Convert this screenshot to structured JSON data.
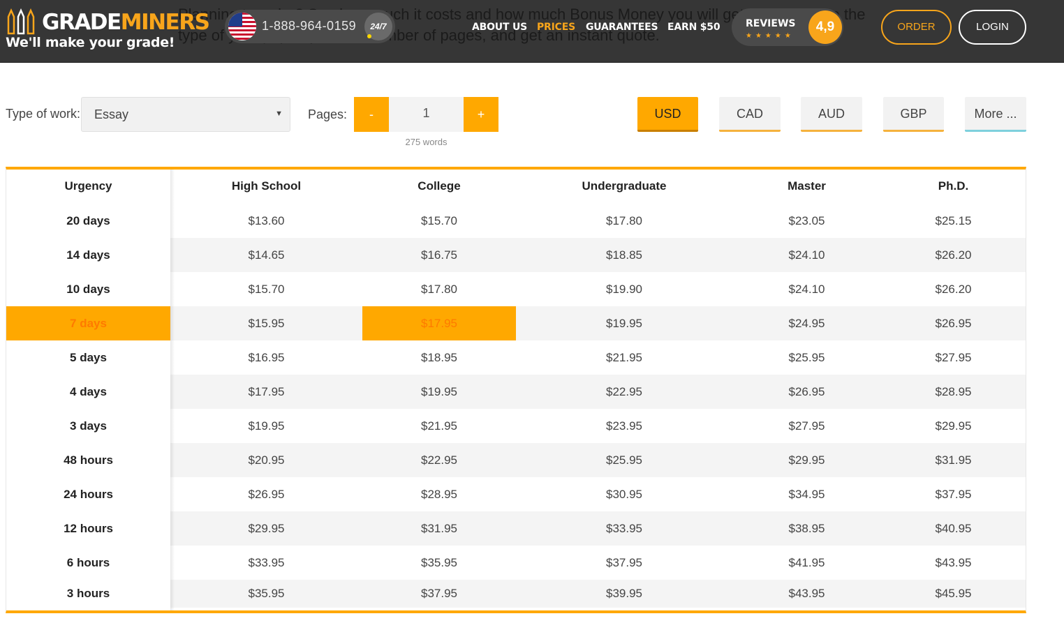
{
  "header": {
    "background_text": "Planning to order? See how much it costs and how much Bonus Money you will get for it. Choose the type of your paper, pick the number of pages, and get an instant quote.",
    "logo_text_1": "GRADE",
    "logo_text_2": "MINERS",
    "tagline": "We'll make your grade!",
    "phone": "1-888-964-0159",
    "support_badge": "24/7",
    "nav": [
      {
        "label": "ABOUT US",
        "active": false
      },
      {
        "label": "PRICES",
        "active": true
      },
      {
        "label": "GUARANTEES",
        "active": false
      },
      {
        "label": "EARN $50",
        "active": false
      }
    ],
    "reviews_label": "REVIEWS",
    "stars": "★★★★★",
    "rating": "4,9",
    "order_label": "ORDER",
    "login_label": "LOGIN"
  },
  "controls": {
    "type_label": "Type of work:",
    "type_value": "Essay",
    "pages_label": "Pages:",
    "minus": "-",
    "plus": "+",
    "pages_value": "1",
    "words": "275 words",
    "currencies": [
      {
        "label": "USD",
        "active": true
      },
      {
        "label": "CAD",
        "active": false
      },
      {
        "label": "AUD",
        "active": false
      },
      {
        "label": "GBP",
        "active": false
      },
      {
        "label": "More ...",
        "active": false
      }
    ]
  },
  "table": {
    "headers": [
      "Urgency",
      "High School",
      "College",
      "Undergraduate",
      "Master",
      "Ph.D."
    ],
    "selected": {
      "row": "7 days",
      "column": "College"
    },
    "rows": [
      {
        "urgency": "20 days",
        "prices": [
          "$13.60",
          "$15.70",
          "$17.80",
          "$23.05",
          "$25.15"
        ]
      },
      {
        "urgency": "14 days",
        "prices": [
          "$14.65",
          "$16.75",
          "$18.85",
          "$24.10",
          "$26.20"
        ]
      },
      {
        "urgency": "10 days",
        "prices": [
          "$15.70",
          "$17.80",
          "$19.90",
          "$24.10",
          "$26.20"
        ]
      },
      {
        "urgency": "7 days",
        "prices": [
          "$15.95",
          "$17.95",
          "$19.95",
          "$24.95",
          "$26.95"
        ]
      },
      {
        "urgency": "5 days",
        "prices": [
          "$16.95",
          "$18.95",
          "$21.95",
          "$25.95",
          "$27.95"
        ]
      },
      {
        "urgency": "4 days",
        "prices": [
          "$17.95",
          "$19.95",
          "$22.95",
          "$26.95",
          "$28.95"
        ]
      },
      {
        "urgency": "3 days",
        "prices": [
          "$19.95",
          "$21.95",
          "$23.95",
          "$27.95",
          "$29.95"
        ]
      },
      {
        "urgency": "48 hours",
        "prices": [
          "$20.95",
          "$22.95",
          "$25.95",
          "$29.95",
          "$31.95"
        ]
      },
      {
        "urgency": "24 hours",
        "prices": [
          "$26.95",
          "$28.95",
          "$30.95",
          "$34.95",
          "$37.95"
        ]
      },
      {
        "urgency": "12 hours",
        "prices": [
          "$29.95",
          "$31.95",
          "$33.95",
          "$38.95",
          "$40.95"
        ]
      },
      {
        "urgency": "6 hours",
        "prices": [
          "$33.95",
          "$35.95",
          "$37.95",
          "$41.95",
          "$43.95"
        ]
      },
      {
        "urgency": "3 hours",
        "prices": [
          "$35.95",
          "$37.95",
          "$39.95",
          "$43.95",
          "$45.95"
        ]
      }
    ]
  },
  "colors": {
    "accent": "#ffa800",
    "header_bg": "#363636",
    "brand_orange": "#f8a51b"
  }
}
